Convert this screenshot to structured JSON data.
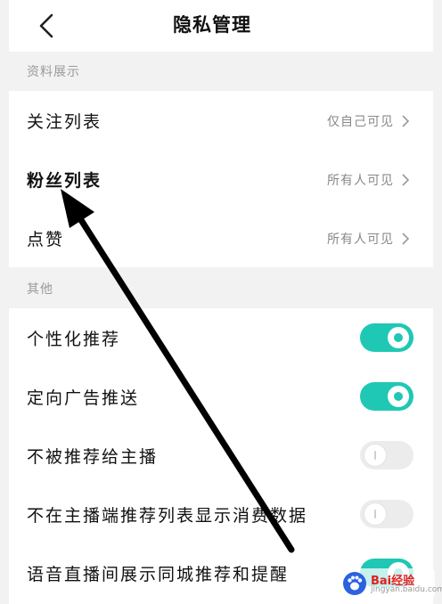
{
  "header": {
    "title": "隐私管理",
    "back_icon": "back-chevron-icon"
  },
  "sections": {
    "profile_display": {
      "label": "资料展示",
      "items": [
        {
          "label": "关注列表",
          "value": "仅自己可见"
        },
        {
          "label": "粉丝列表",
          "value": "所有人可见"
        },
        {
          "label": "点赞",
          "value": "所有人可见"
        }
      ]
    },
    "other": {
      "label": "其他",
      "items": [
        {
          "label": "个性化推荐",
          "enabled": true
        },
        {
          "label": "定向广告推送",
          "enabled": true
        },
        {
          "label": "不被推荐给主播",
          "enabled": false
        },
        {
          "label": "不在主播端推荐列表显示消费数据",
          "enabled": false
        },
        {
          "label": "语音直播间展示同城推荐和提醒",
          "enabled": true
        }
      ]
    }
  },
  "colors": {
    "toggle_on": "#1ec8b4",
    "toggle_off": "#ececec",
    "annotation_arrow": "#000000"
  },
  "watermark": {
    "logo": "baidu-paw-logo",
    "brand": "Bai经验",
    "url": "jingyan.baidu.com"
  }
}
